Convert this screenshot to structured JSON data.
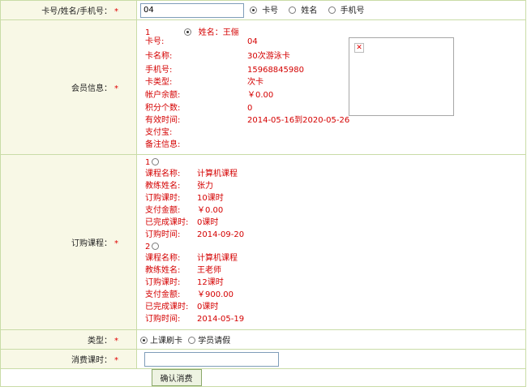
{
  "search": {
    "label": "卡号/姓名/手机号：",
    "required": "*",
    "value": "04",
    "options": [
      "卡号",
      "姓名",
      "手机号"
    ],
    "selected": 0
  },
  "member": {
    "label": "会员信息：",
    "required": "*",
    "index": "1",
    "name_label": "姓名：王俪",
    "fields": [
      {
        "label": "卡号:",
        "value": "04"
      },
      {
        "label": "卡名称:",
        "value": "30次游泳卡"
      },
      {
        "label": "手机号:",
        "value": "15968845980"
      },
      {
        "label": "卡类型:",
        "value": "次卡"
      },
      {
        "label": "帐户余额:",
        "value": "￥0.00"
      },
      {
        "label": "积分个数:",
        "value": "0"
      },
      {
        "label": "有效时间:",
        "value": "2014-05-16到2020-05-26"
      },
      {
        "label": "支付宝:",
        "value": ""
      },
      {
        "label": "备注信息:",
        "value": ""
      }
    ]
  },
  "courses": {
    "label": "订购课程：",
    "required": "*",
    "items": [
      {
        "index": "1",
        "fields": [
          {
            "label": "课程名称:",
            "value": "计算机课程"
          },
          {
            "label": "教练姓名:",
            "value": "张力"
          },
          {
            "label": "订购课时:",
            "value": "10课时"
          },
          {
            "label": "支付金额:",
            "value": "￥0.00"
          },
          {
            "label": "已完成课时:",
            "value": "0课时"
          },
          {
            "label": "订购时间:",
            "value": "2014-09-20"
          }
        ]
      },
      {
        "index": "2",
        "fields": [
          {
            "label": "课程名称:",
            "value": "计算机课程"
          },
          {
            "label": "教练姓名:",
            "value": "王老师"
          },
          {
            "label": "订购课时:",
            "value": "12课时"
          },
          {
            "label": "支付金额:",
            "value": "￥900.00"
          },
          {
            "label": "已完成课时:",
            "value": "0课时"
          },
          {
            "label": "订购时间:",
            "value": "2014-05-19"
          }
        ]
      }
    ]
  },
  "type": {
    "label": "类型：",
    "required": "*",
    "options": [
      "上课刷卡",
      "学员请假"
    ],
    "selected": 0
  },
  "hours": {
    "label": "消费课时：",
    "required": "*",
    "value": ""
  },
  "submit": {
    "label": "确认消费"
  },
  "colors": {
    "border": "#c9dca7",
    "label_bg": "#f8f8e6",
    "value_text": "#d40000",
    "required": "#e00000"
  }
}
